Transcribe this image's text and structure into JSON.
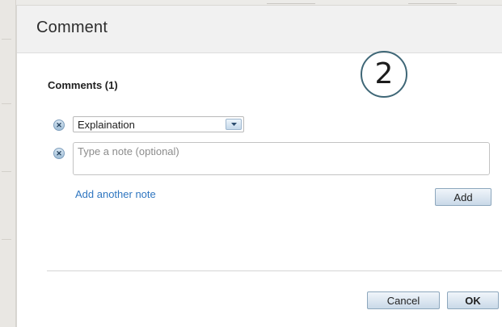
{
  "dialog": {
    "title": "Comment",
    "section_title": "Comments (1)",
    "step_marker": "2"
  },
  "comment_row": {
    "selected_type": "Explaination",
    "remove_icon": "x-icon"
  },
  "note": {
    "placeholder": "Type a note (optional)",
    "value": "",
    "remove_icon": "x-icon"
  },
  "actions": {
    "add_another_note": "Add another note",
    "add": "Add",
    "cancel": "Cancel",
    "ok": "OK"
  },
  "colors": {
    "link": "#2f76c0",
    "header_bg": "#f1f1f1",
    "button_border": "#8da7bd"
  }
}
